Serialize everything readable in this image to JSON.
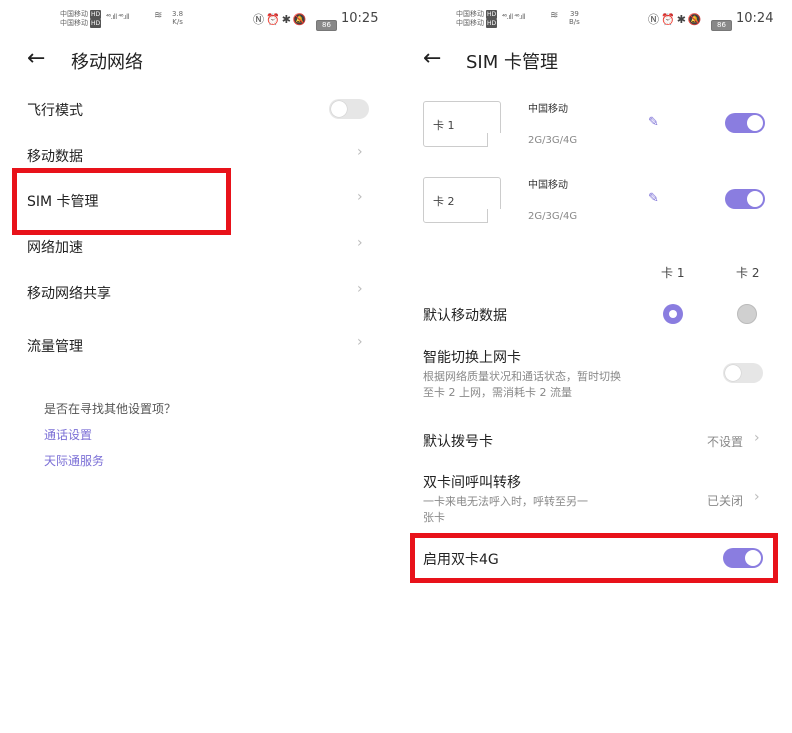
{
  "left": {
    "status_bar": {
      "carrier1": "中国移动",
      "carrier2": "中国移动",
      "hd": "HD",
      "signal": "⁴⁶.ıll ⁴⁶.ıll",
      "speed_value": "3.8",
      "speed_unit": "K/s",
      "battery": "86",
      "time": "10:25"
    },
    "header": {
      "title": "移动网络"
    },
    "items": [
      {
        "label": "飞行模式"
      },
      {
        "label": "移动数据"
      },
      {
        "label": "SIM 卡管理"
      },
      {
        "label": "网络加速"
      },
      {
        "label": "移动网络共享"
      },
      {
        "label": "流量管理"
      }
    ],
    "prompt": "是否在寻找其他设置项？",
    "links": [
      "通话设置",
      "天际通服务"
    ]
  },
  "right": {
    "status_bar": {
      "carrier1": "中国移动",
      "carrier2": "中国移动",
      "hd": "HD",
      "signal": "⁴⁶.ıll ⁴⁶.ıll",
      "speed_value": "39",
      "speed_unit": "B/s",
      "battery": "86",
      "time": "10:24"
    },
    "header": {
      "title": "SIM 卡管理"
    },
    "sims": [
      {
        "label": "卡 1",
        "carrier": "中国移动",
        "network": "2G/3G/4G",
        "enabled": true
      },
      {
        "label": "卡 2",
        "carrier": "中国移动",
        "network": "2G/3G/4G",
        "enabled": true
      }
    ],
    "columns": [
      "卡 1",
      "卡 2"
    ],
    "default_data": {
      "label": "默认移动数据",
      "selected": "卡 1"
    },
    "smart_switch": {
      "label": "智能切换上网卡",
      "desc_line1": "根据网络质量状况和通话状态，暂时切换",
      "desc_line2": "至卡 2 上网，需消耗卡 2 流量",
      "enabled": false
    },
    "default_dial": {
      "label": "默认拨号卡",
      "value": "不设置"
    },
    "call_forward": {
      "label": "双卡间呼叫转移",
      "desc_line1": "一卡来电无法呼入时，呼转至另一",
      "desc_line2": "张卡",
      "value": "已关闭"
    },
    "dual_4g": {
      "label": "启用双卡4G",
      "enabled": true
    }
  },
  "colors": {
    "accent": "#8a7de0",
    "highlight": "#e8121a",
    "link": "#7b6fd6"
  }
}
